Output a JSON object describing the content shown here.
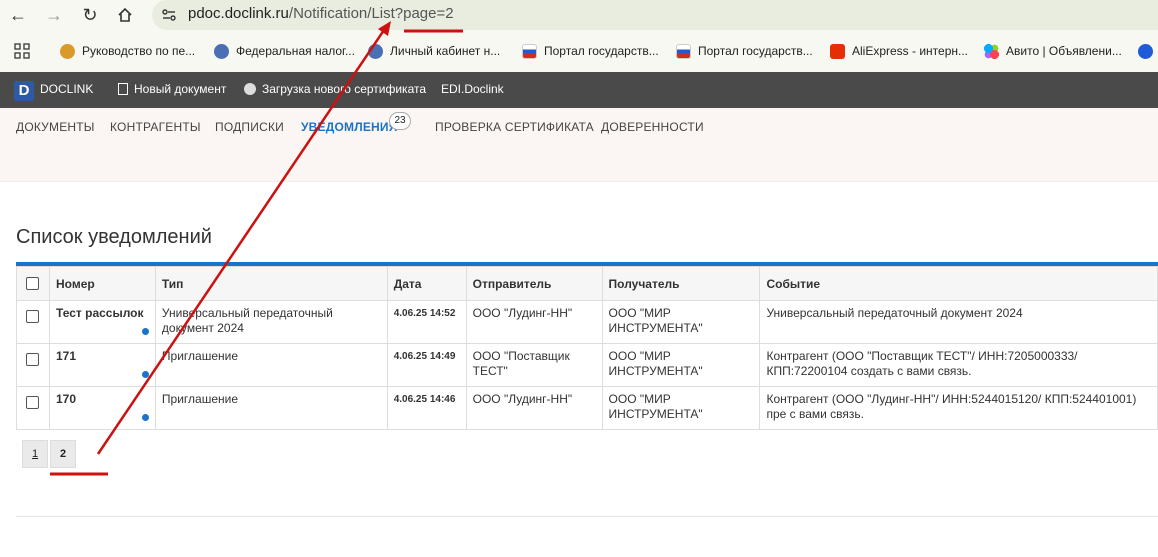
{
  "browser": {
    "url_host": "pdoc.doclink.ru",
    "url_path": "/Notification/List?page=2",
    "bookmarks": [
      {
        "label": "Руководство по пе...",
        "color": "#d99a2b"
      },
      {
        "label": "Федеральная налог...",
        "color": "#4a6fb3"
      },
      {
        "label": "Личный кабинет н...",
        "color": "#4a6fb3"
      },
      {
        "label": "Портал государств...",
        "color": "#1f5bd6"
      },
      {
        "label": "Портал государств...",
        "color": "#1f5bd6"
      },
      {
        "label": "AliExpress - интерн...",
        "color": "#e62e04"
      },
      {
        "label": "Авито | Объявлени...",
        "color": "#7a4be3"
      }
    ]
  },
  "appbar": {
    "logo": "D",
    "brand": "DOCLINK",
    "new_doc": "Новый документ",
    "upload_cert": "Загрузка нового сертификата",
    "edi": "EDI.Doclink"
  },
  "tabs": [
    "ДОКУМЕНТЫ",
    "КОНТРАГЕНТЫ",
    "ПОДПИСКИ",
    "УВЕДОМЛЕНИЯ",
    "ПРОВЕРКА СЕРТИФИКАТА",
    "ДОВЕРЕННОСТИ"
  ],
  "notifications_count": "23",
  "page_title": "Список уведомлений",
  "table": {
    "headers": [
      "Номер",
      "Тип",
      "Дата",
      "Отправитель",
      "Получатель",
      "Событие"
    ],
    "rows": [
      {
        "number": "Тест рассылок",
        "type": "Универсальный передаточный документ 2024",
        "date": "4.06.25 14:52",
        "sender": "ООО \"Лудинг-НН\"",
        "recipient": "ООО \"МИР ИНСТРУМЕНТА\"",
        "event": "Универсальный передаточный документ 2024"
      },
      {
        "number": "171",
        "type": "Приглашение",
        "date": "4.06.25 14:49",
        "sender": "ООО \"Поставщик ТЕСТ\"",
        "recipient": "ООО \"МИР ИНСТРУМЕНТА\"",
        "event": "Контрагент (ООО \"Поставщик ТЕСТ\"/ ИНН:7205000333/ КПП:72200104 создать с вами связь."
      },
      {
        "number": "170",
        "type": "Приглашение",
        "date": "4.06.25 14:46",
        "sender": "ООО \"Лудинг-НН\"",
        "recipient": "ООО \"МИР ИНСТРУМЕНТА\"",
        "event": "Контрагент (ООО \"Лудинг-НН\"/ ИНН:5244015120/ КПП:524401001) пре с вами связь."
      }
    ]
  },
  "pager": {
    "pages": [
      "1",
      "2"
    ],
    "current": "2"
  },
  "annotation_color": "#cc1111"
}
